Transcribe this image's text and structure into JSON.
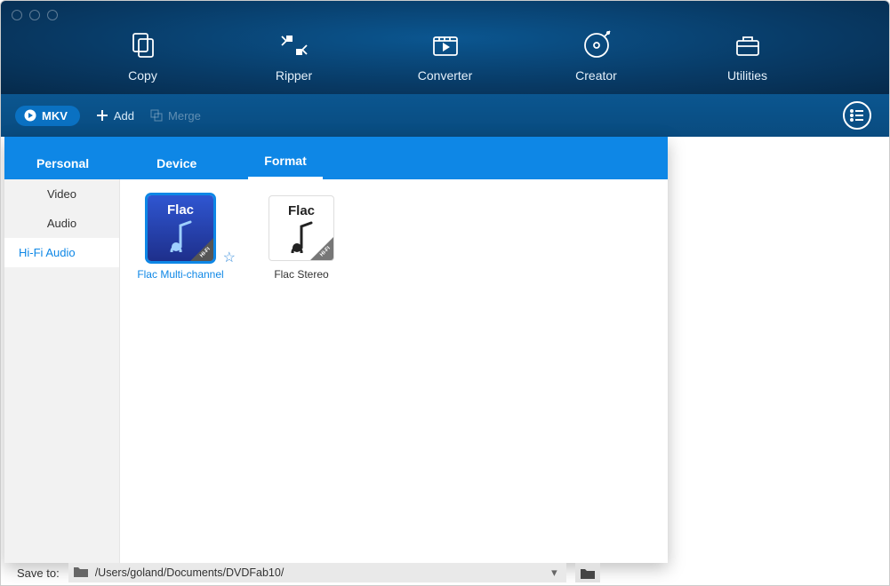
{
  "main_nav": {
    "copy": "Copy",
    "ripper": "Ripper",
    "converter": "Converter",
    "creator": "Creator",
    "utilities": "Utilities"
  },
  "toolbar": {
    "mode_pill": "MKV",
    "add": "Add",
    "merge": "Merge"
  },
  "panel_tabs": {
    "personal": "Personal",
    "device": "Device",
    "format": "Format"
  },
  "sidebar": {
    "items": [
      {
        "label": "Video"
      },
      {
        "label": "Audio"
      },
      {
        "label": "Hi-Fi Audio"
      }
    ]
  },
  "formats": [
    {
      "thumb_label": "Flac",
      "caption": "Flac Multi-channel",
      "badge": "HI-FI",
      "selected": true
    },
    {
      "thumb_label": "Flac",
      "caption": "Flac Stereo",
      "badge": "HI-FI",
      "selected": false
    }
  ],
  "save_bar": {
    "label": "Save to:",
    "path": "/Users/goland/Documents/DVDFab10/"
  }
}
